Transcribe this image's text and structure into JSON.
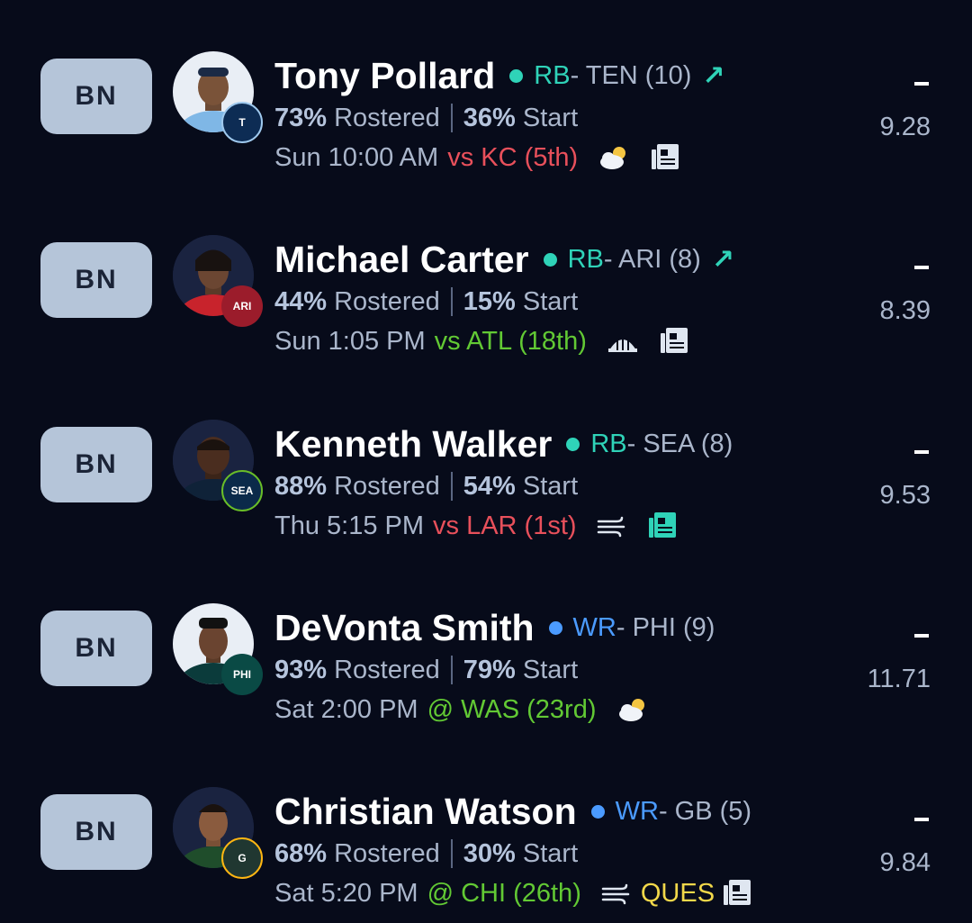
{
  "colors": {
    "background": "#070b1a",
    "slot_bg": "#b5c5d9",
    "rb_accent": "#2fd3b8",
    "wr_accent": "#4b9bff",
    "bad_matchup": "#e8505b",
    "good_matchup": "#62c934",
    "questionable": "#f2d84a",
    "news_active": "#2fd3b8"
  },
  "players": [
    {
      "slot": "BN",
      "name": "Tony Pollard",
      "position": "RB",
      "team": " - TEN (10)",
      "trend": "up-trend-icon",
      "rostered_pct": "73%",
      "rostered_label": "Rostered",
      "start_pct": "36%",
      "start_label": "Start",
      "game_time": "Sun 10:00 AM",
      "opponent": "vs KC (5th)",
      "matchup": "bad",
      "weather": "partly-cloudy-icon",
      "news": "news-icon",
      "projection_dash": "-",
      "projection": "9.28"
    },
    {
      "slot": "BN",
      "name": "Michael Carter",
      "position": "RB",
      "team": " - ARI (8)",
      "trend": "up-trend-icon",
      "rostered_pct": "44%",
      "rostered_label": "Rostered",
      "start_pct": "15%",
      "start_label": "Start",
      "game_time": "Sun 1:05 PM",
      "opponent": "vs ATL (18th)",
      "matchup": "good",
      "weather": "dome-icon",
      "news": "news-icon",
      "projection_dash": "-",
      "projection": "8.39"
    },
    {
      "slot": "BN",
      "name": "Kenneth Walker",
      "position": "RB",
      "team": " - SEA (8)",
      "trend": "",
      "rostered_pct": "88%",
      "rostered_label": "Rostered",
      "start_pct": "54%",
      "start_label": "Start",
      "game_time": "Thu 5:15 PM",
      "opponent": "vs LAR (1st)",
      "matchup": "bad",
      "weather": "wind-icon",
      "news": "news-active-icon",
      "projection_dash": "-",
      "projection": "9.53"
    },
    {
      "slot": "BN",
      "name": "DeVonta Smith",
      "position": "WR",
      "team": " - PHI (9)",
      "trend": "",
      "rostered_pct": "93%",
      "rostered_label": "Rostered",
      "start_pct": "79%",
      "start_label": "Start",
      "game_time": "Sat 2:00 PM",
      "opponent": "@ WAS (23rd)",
      "matchup": "good",
      "weather": "partly-cloudy-icon",
      "news": "",
      "projection_dash": "-",
      "projection": "11.71"
    },
    {
      "slot": "BN",
      "name": "Christian Watson",
      "position": "WR",
      "team": " - GB (5)",
      "trend": "",
      "rostered_pct": "68%",
      "rostered_label": "Rostered",
      "start_pct": "30%",
      "start_label": "Start",
      "game_time": "Sat 5:20 PM",
      "opponent": "@ CHI (26th)",
      "matchup": "good",
      "weather": "wind-icon",
      "status": "QUES",
      "news": "news-icon",
      "projection_dash": "-",
      "projection": "9.84"
    }
  ]
}
